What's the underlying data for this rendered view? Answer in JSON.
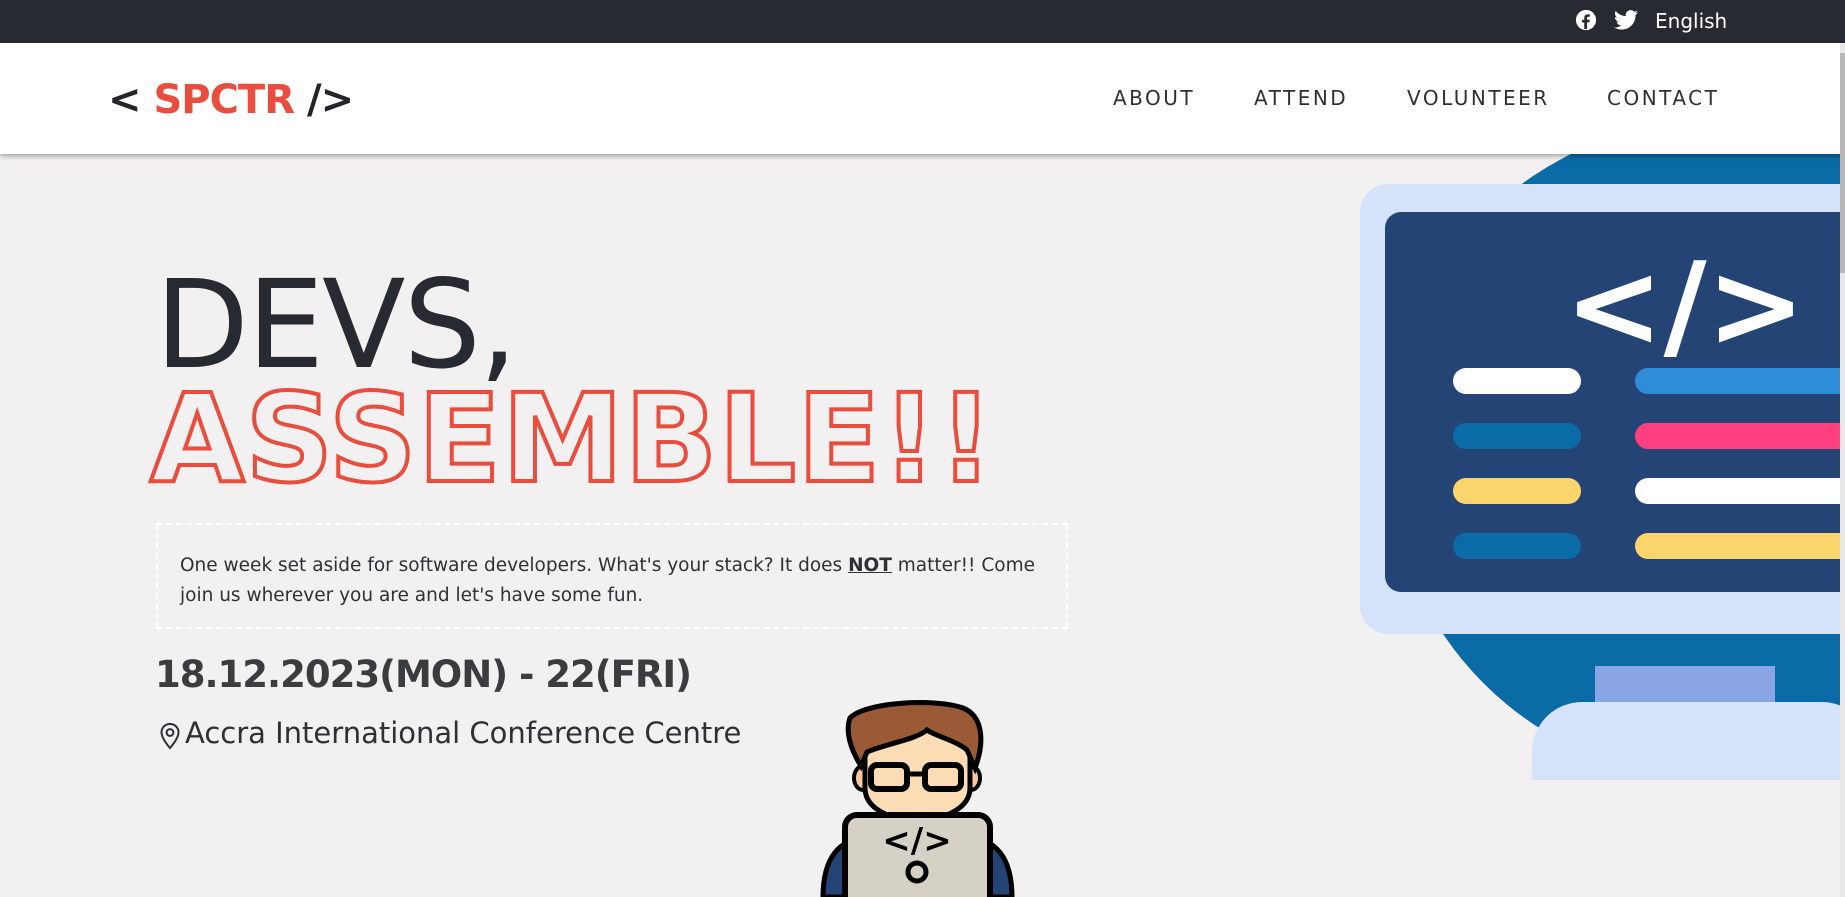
{
  "topbar": {
    "facebook_icon": "facebook-icon",
    "twitter_icon": "twitter-icon",
    "language": "English"
  },
  "header": {
    "logo": {
      "open": "<",
      "brand": "SPCTR",
      "close": "/>"
    },
    "nav": [
      "ABOUT",
      "ATTEND",
      "VOLUNTEER",
      "CONTACT"
    ]
  },
  "hero": {
    "line1": "DEVS,",
    "line2": "ASSEMBLE!!",
    "description_before": "One week set aside for software developers. What's your stack? It does ",
    "description_emphasis": "NOT",
    "description_after": " matter!! Come join us wherever you are and let's have some fun.",
    "dates": "18.12.2023(MON) - 22(FRI)",
    "venue_icon": "location-pin-icon",
    "venue": "Accra International Conference Centre"
  },
  "illustrations": {
    "monitor": "monitor-code-illustration",
    "monitor_code_glyph": "</>",
    "developer": "developer-with-laptop-illustration",
    "laptop_code_glyph": "</>"
  },
  "colors": {
    "topbar_bg": "#272a31",
    "accent": "#e84d3d",
    "page_bg": "#f3f0f1",
    "text": "#2e3035"
  }
}
